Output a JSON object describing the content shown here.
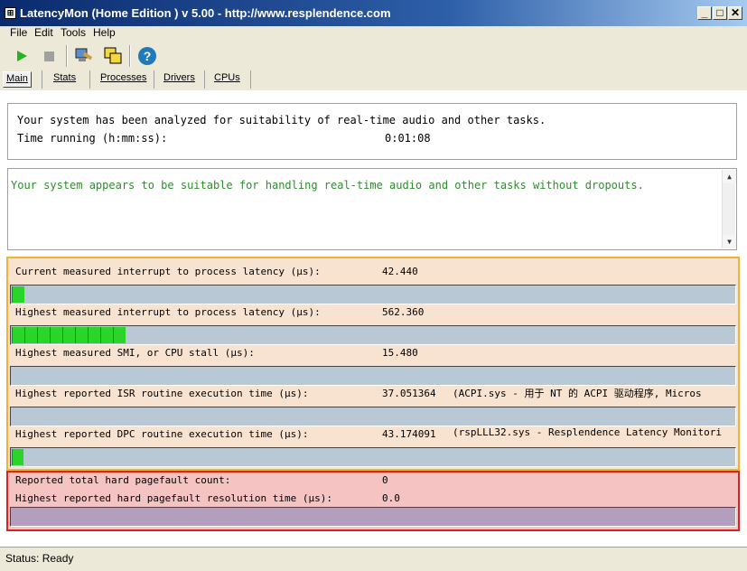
{
  "window": {
    "title": "LatencyMon  (Home Edition )  v 5.00 - http://www.resplendence.com",
    "minimize": "_",
    "maximize": "□",
    "close": "✕"
  },
  "menu": [
    "File",
    "Edit",
    "Tools",
    "Help"
  ],
  "toolbar": {
    "start_icon": "play-icon",
    "stop_icon": "stop-icon",
    "analyze_icon": "computer-wrench-icon",
    "window_icon": "windows-icon",
    "help_icon": "help-icon"
  },
  "tabs": [
    "Main",
    "Stats",
    "Processes",
    "Drivers",
    "CPUs"
  ],
  "summary": {
    "line1": "Your system has been analyzed for suitability of real-time audio and other tasks.",
    "time_label": "Time running (h:mm:ss):",
    "time_value": "0:01:08"
  },
  "verdict": {
    "text": "Your system appears to be suitable for handling real-time audio and other tasks without dropouts.",
    "color": "#2e8b2e"
  },
  "latency_rows": [
    {
      "label": "Current measured interrupt to process latency (µs):",
      "value": "42.440",
      "detail": "",
      "bar_fraction": 0.017
    },
    {
      "label": "Highest measured interrupt to process latency (µs):",
      "value": "562.360",
      "detail": "",
      "bar_fraction": 0.157
    },
    {
      "label": "Highest measured SMI, or CPU stall (µs):",
      "value": "15.480",
      "detail": "",
      "bar_fraction": 0.0
    },
    {
      "label": "Highest reported ISR routine execution time (µs):",
      "value": "37.051364",
      "detail": "(ACPI.sys - 用于 NT 的 ACPI 驱动程序, Micros",
      "bar_fraction": 0.0
    },
    {
      "label": "Highest reported DPC routine execution time (µs):",
      "value": "43.174091",
      "detail": "(rspLLL32.sys - Resplendence Latency Monitori",
      "bar_fraction": 0.016
    }
  ],
  "pagefault": {
    "count_label": "Reported total hard pagefault count:",
    "count_value": "0",
    "time_label": "Highest reported hard pagefault resolution time (µs):",
    "time_value": "0.0"
  },
  "colors": {
    "latency_border": "#f4b13a",
    "pagefault_border": "#e02020",
    "bar_fill": "#2bd42b"
  },
  "status": "Status: Ready"
}
